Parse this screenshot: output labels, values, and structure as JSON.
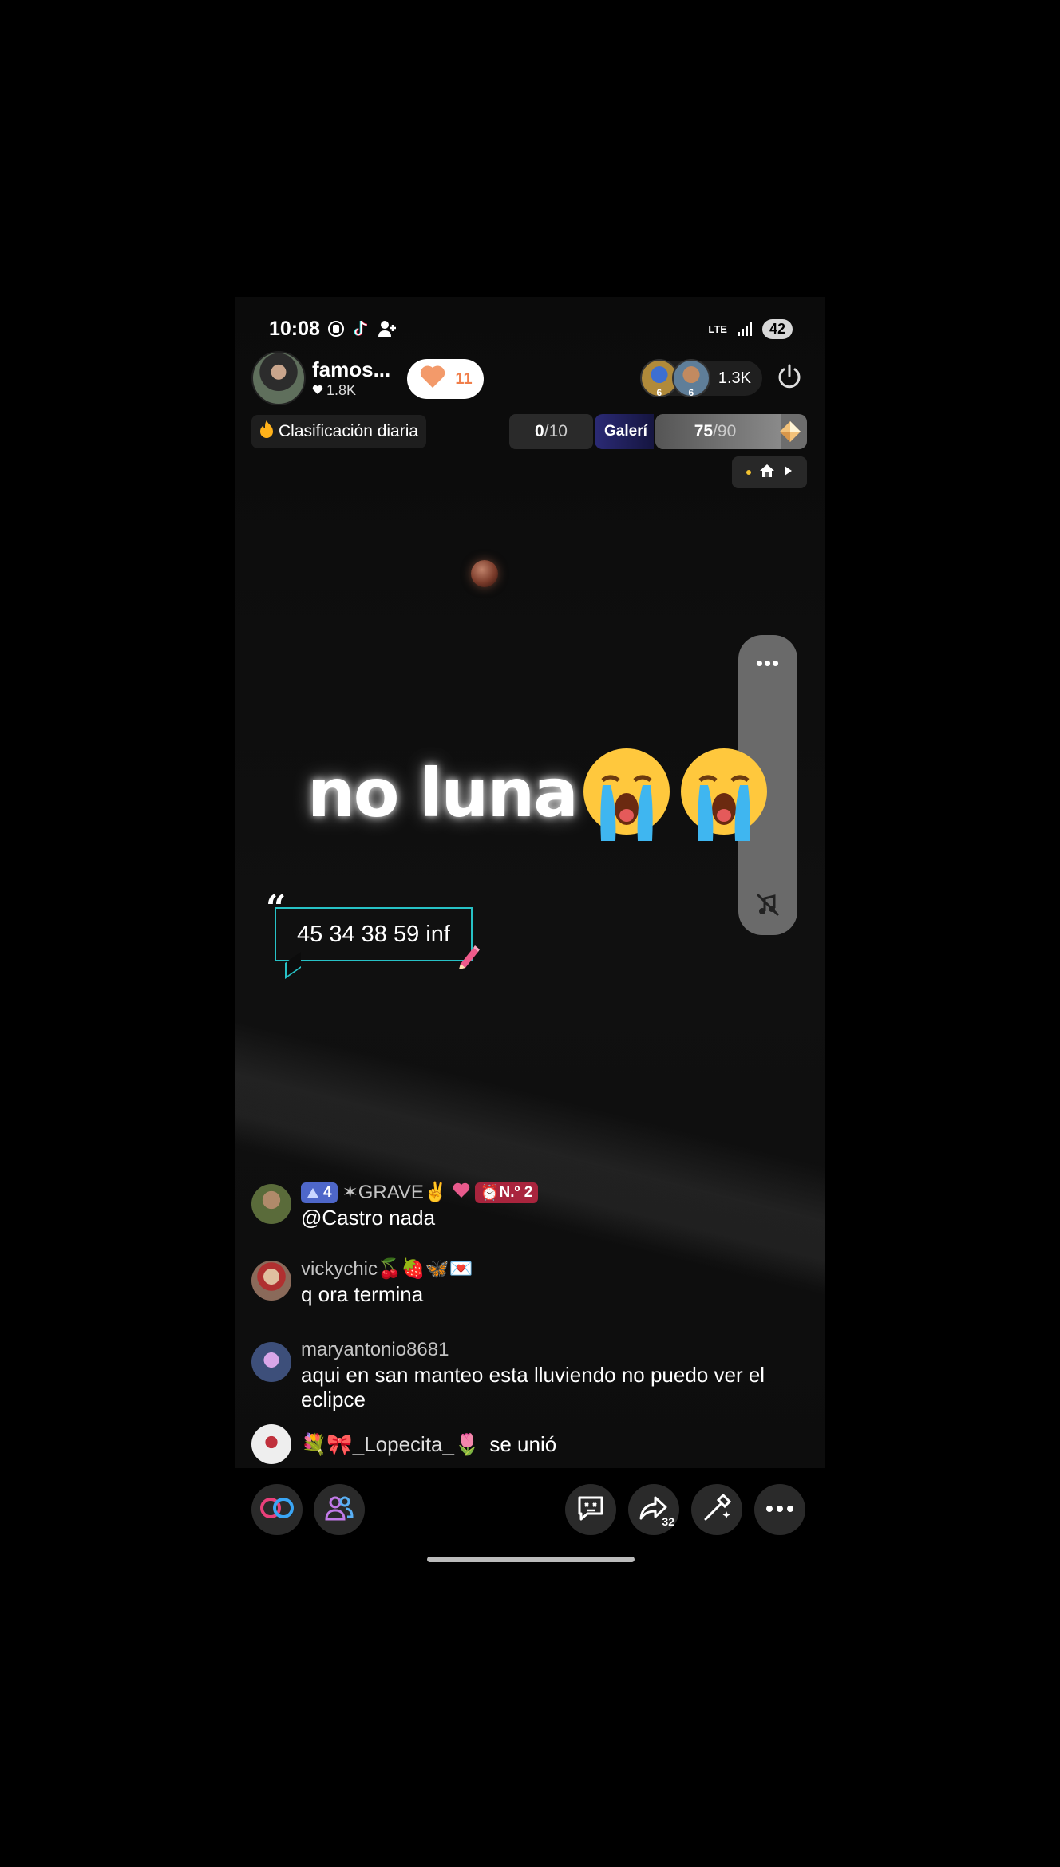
{
  "status_bar": {
    "time": "10:08",
    "network": "LTE",
    "battery": "42"
  },
  "host": {
    "name": "famos...",
    "likes": "1.8K",
    "follow_count": "11"
  },
  "viewers": {
    "count": "1.3K",
    "badges": [
      "6",
      "6"
    ]
  },
  "ranking": {
    "label": "Clasificación diaria"
  },
  "goal": {
    "current": "0",
    "total": "/10"
  },
  "gallery": {
    "label": "Galerí"
  },
  "progress": {
    "current": "75",
    "total": "/90",
    "fraction": 0.833
  },
  "overlay": {
    "caption": "no luna",
    "quote": "45 34 38 59 inf"
  },
  "side_panel": {
    "more": "•••"
  },
  "chat": [
    {
      "level": "4",
      "name": "✶GRAVE✌",
      "rank": "N.º 2",
      "text": "@Castro nada",
      "avatar_color": "#5a6b3a"
    },
    {
      "name": "vickychic🍒🍓🦋💌",
      "text": "q ora termina",
      "avatar_color": "#8a6a5a"
    },
    {
      "name": "maryantonio8681",
      "text": "aqui en san manteo esta lluviendo no puedo ver el eclipce",
      "avatar_color": "#6a7aa8"
    }
  ],
  "joined": {
    "name": "💐🎀_Lopecita_🌷",
    "action": "se unió"
  },
  "bottom": {
    "share_count": "32"
  },
  "colors": {
    "accent": "#27c2c6",
    "follow": "#f07e4a",
    "level": "#4e67c9",
    "rank": "#a9243d"
  }
}
